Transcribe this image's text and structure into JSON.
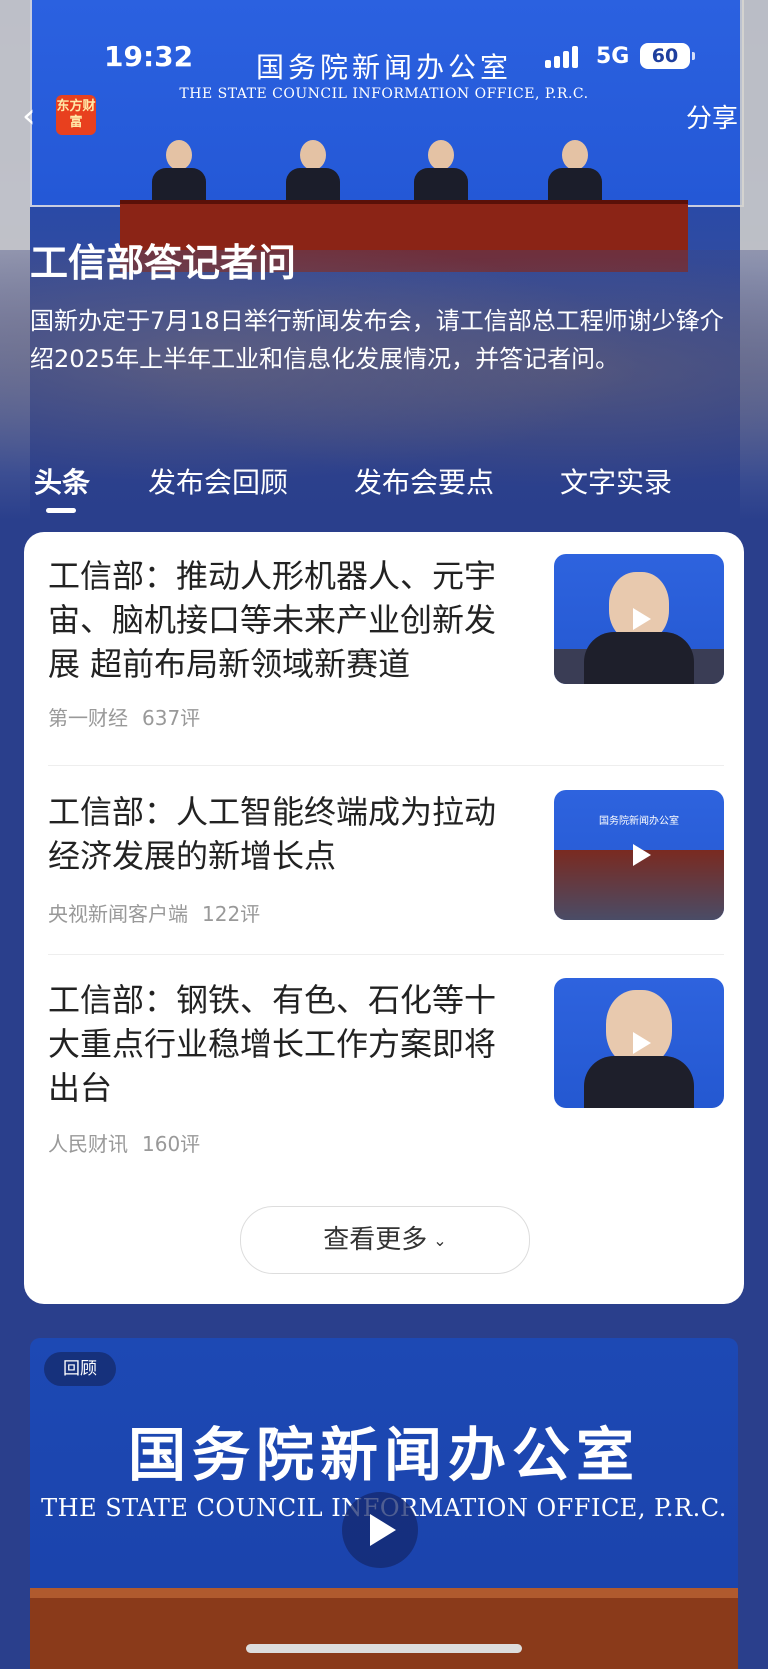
{
  "status": {
    "time": "19:32",
    "network": "5G",
    "battery": "60"
  },
  "header": {
    "logo_text": "东方财富",
    "share_label": "分享"
  },
  "hero": {
    "banner_cn": "国务院新闻办公室",
    "banner_en": "THE STATE COUNCIL INFORMATION OFFICE, P.R.C.",
    "title": "工信部答记者问",
    "description": "国新办定于7月18日举行新闻发布会，请工信部总工程师谢少锋介绍2025年上半年工业和信息化发展情况，并答记者问。"
  },
  "tabs": [
    {
      "label": "头条",
      "active": true
    },
    {
      "label": "发布会回顾",
      "active": false
    },
    {
      "label": "发布会要点",
      "active": false
    },
    {
      "label": "文字实录",
      "active": false
    }
  ],
  "news": [
    {
      "title": "工信部：推动人形机器人、元宇宙、脑机接口等未来产业创新发展 超前布局新领域新赛道",
      "source": "第一财经",
      "comments": "637评"
    },
    {
      "title": "工信部：人工智能终端成为拉动经济发展的新增长点",
      "source": "央视新闻客户端",
      "comments": "122评"
    },
    {
      "title": "工信部：钢铁、有色、石化等十大重点行业稳增长工作方案即将出台",
      "source": "人民财讯",
      "comments": "160评"
    }
  ],
  "more_label": "查看更多",
  "replay": {
    "tag": "回顾",
    "banner_cn": "国务院新闻办公室",
    "banner_en": "THE STATE COUNCIL INFORMATION OFFICE, P.R.C."
  },
  "colors": {
    "background": "#2a3f8c",
    "card": "#ffffff",
    "brand_logo": "#e8401e"
  }
}
